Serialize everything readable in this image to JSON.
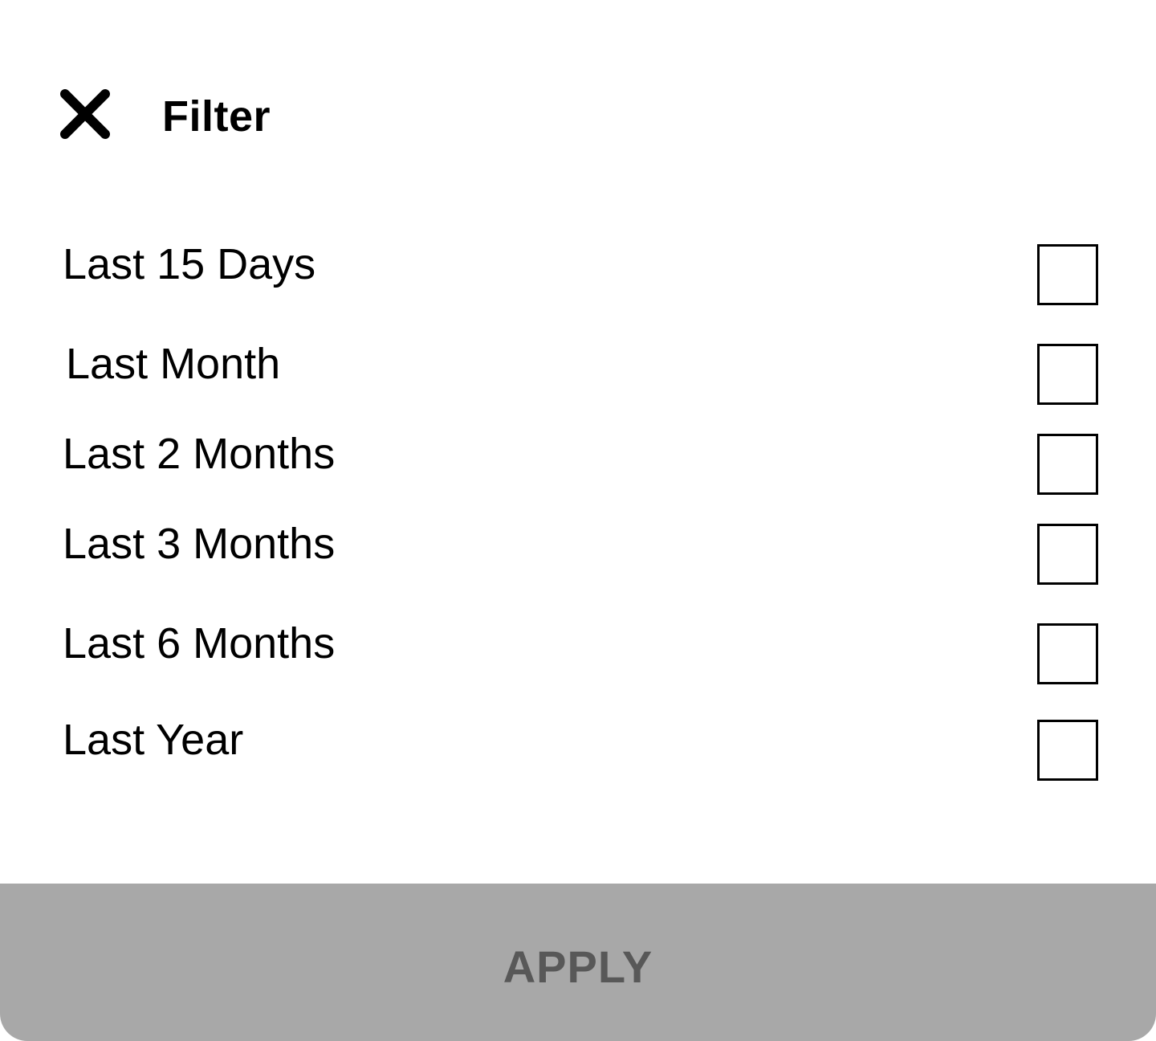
{
  "header": {
    "close_icon": "close-icon",
    "title": "Filter"
  },
  "options": [
    {
      "label": "Last 15 Days",
      "checked": false
    },
    {
      "label": "Last Month",
      "checked": false
    },
    {
      "label": "Last 2 Months",
      "checked": false
    },
    {
      "label": "Last 3 Months",
      "checked": false
    },
    {
      "label": "Last 6 Months",
      "checked": false
    },
    {
      "label": "Last Year",
      "checked": false
    }
  ],
  "apply_button": {
    "label": "APPLY",
    "background": "#a8a8a8",
    "text_color": "#585858"
  }
}
